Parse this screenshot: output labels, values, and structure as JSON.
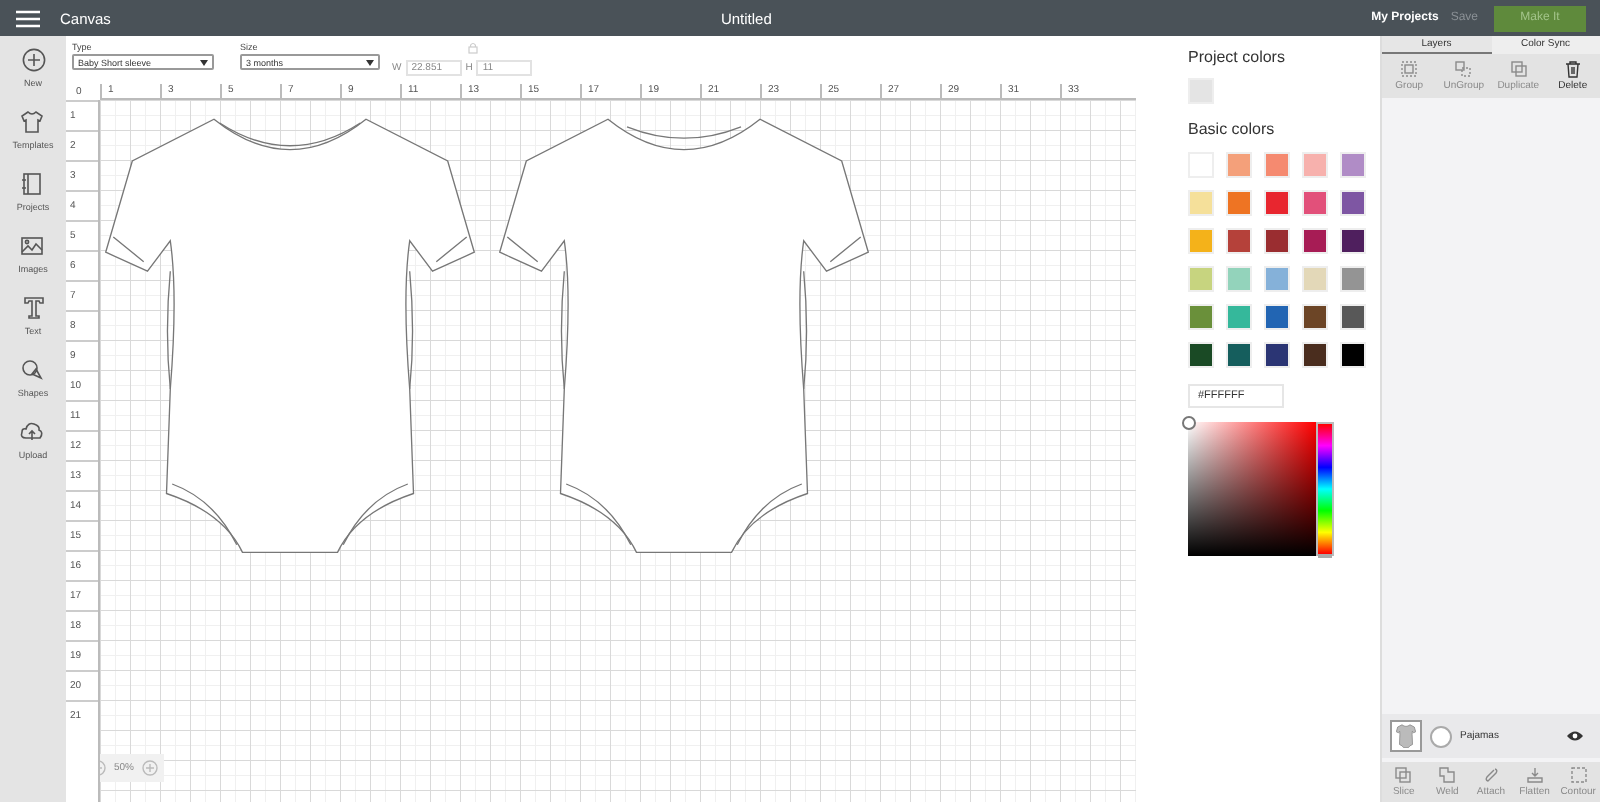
{
  "top_bar": {
    "app_name": "Canvas",
    "title": "Untitled",
    "my_projects": "My Projects",
    "save": "Save",
    "make_it": "Make It"
  },
  "sidebar": {
    "items": [
      {
        "label": "New",
        "kind": "plus"
      },
      {
        "label": "Templates",
        "kind": "shirt"
      },
      {
        "label": "Projects",
        "kind": "book"
      },
      {
        "label": "Images",
        "kind": "image"
      },
      {
        "label": "Text",
        "kind": "text"
      },
      {
        "label": "Shapes",
        "kind": "shapes"
      },
      {
        "label": "Upload",
        "kind": "upload"
      }
    ]
  },
  "toolbar": {
    "type_label": "Type",
    "type_value": "Baby Short sleeve",
    "size_label": "Size",
    "size_value": "3 months",
    "width_label": "W",
    "width_value": "22.851",
    "height_label": "H",
    "height_value": "11"
  },
  "canvas": {
    "corner": "0",
    "top_ruler": [
      "1",
      "3",
      "5",
      "7",
      "9",
      "11",
      "13",
      "15",
      "17",
      "19",
      "21",
      "23",
      "25",
      "27",
      "29",
      "31",
      "33"
    ],
    "left_ruler": [
      "1",
      "2",
      "3",
      "4",
      "5",
      "6",
      "7",
      "8",
      "9",
      "10",
      "11",
      "12",
      "13",
      "14",
      "15",
      "16",
      "17",
      "18",
      "19",
      "20",
      "21"
    ],
    "zoom": "50%"
  },
  "color_panel": {
    "project_title": "Project colors",
    "project_colors": [
      {
        "color": "#e4e4e4"
      }
    ],
    "basic_title": "Basic colors",
    "swatches": [
      {
        "color": "#ffffff"
      },
      {
        "color": "#f4a07a"
      },
      {
        "color": "#f58a70"
      },
      {
        "color": "#f7b1ad"
      },
      {
        "color": "#b08cc6"
      },
      {
        "color": "#f5e09a"
      },
      {
        "color": "#ee7423"
      },
      {
        "color": "#e8262f"
      },
      {
        "color": "#e2507a"
      },
      {
        "color": "#7e56a3"
      },
      {
        "color": "#f4b21a"
      },
      {
        "color": "#b5413a"
      },
      {
        "color": "#9a2d30"
      },
      {
        "color": "#a71c55"
      },
      {
        "color": "#4f1f5e"
      },
      {
        "color": "#c7d47f"
      },
      {
        "color": "#93d3bb"
      },
      {
        "color": "#85b1d9"
      },
      {
        "color": "#e3d8b8"
      },
      {
        "color": "#949494"
      },
      {
        "color": "#6a903a"
      },
      {
        "color": "#35b89b"
      },
      {
        "color": "#2265b3"
      },
      {
        "color": "#6c4526"
      },
      {
        "color": "#585858"
      },
      {
        "color": "#1a4a25"
      },
      {
        "color": "#155e5d"
      },
      {
        "color": "#2b3574"
      },
      {
        "color": "#4a2d1e"
      },
      {
        "color": "#000000"
      }
    ],
    "hex_value": "#FFFFFF",
    "hue": {
      "level": 0
    }
  },
  "layers_panel": {
    "tabs": [
      {
        "label": "Layers",
        "selected": true
      },
      {
        "label": "Color Sync",
        "selected": false
      }
    ],
    "tools": [
      {
        "label": "Group",
        "kind": "group",
        "disabled": true
      },
      {
        "label": "UnGroup",
        "kind": "ungroup",
        "disabled": true
      },
      {
        "label": "Duplicate",
        "kind": "duplicate",
        "disabled": true
      },
      {
        "label": "Delete",
        "kind": "delete",
        "disabled": false
      }
    ],
    "layers": [
      {
        "name": "Pajamas",
        "visible": true
      }
    ],
    "bottom_tools": [
      {
        "label": "Slice",
        "kind": "slice",
        "disabled": true
      },
      {
        "label": "Weld",
        "kind": "weld",
        "disabled": true
      },
      {
        "label": "Attach",
        "kind": "attach",
        "disabled": true
      },
      {
        "label": "Flatten",
        "kind": "flatten",
        "disabled": true
      },
      {
        "label": "Contour",
        "kind": "contour",
        "disabled": true
      }
    ]
  }
}
